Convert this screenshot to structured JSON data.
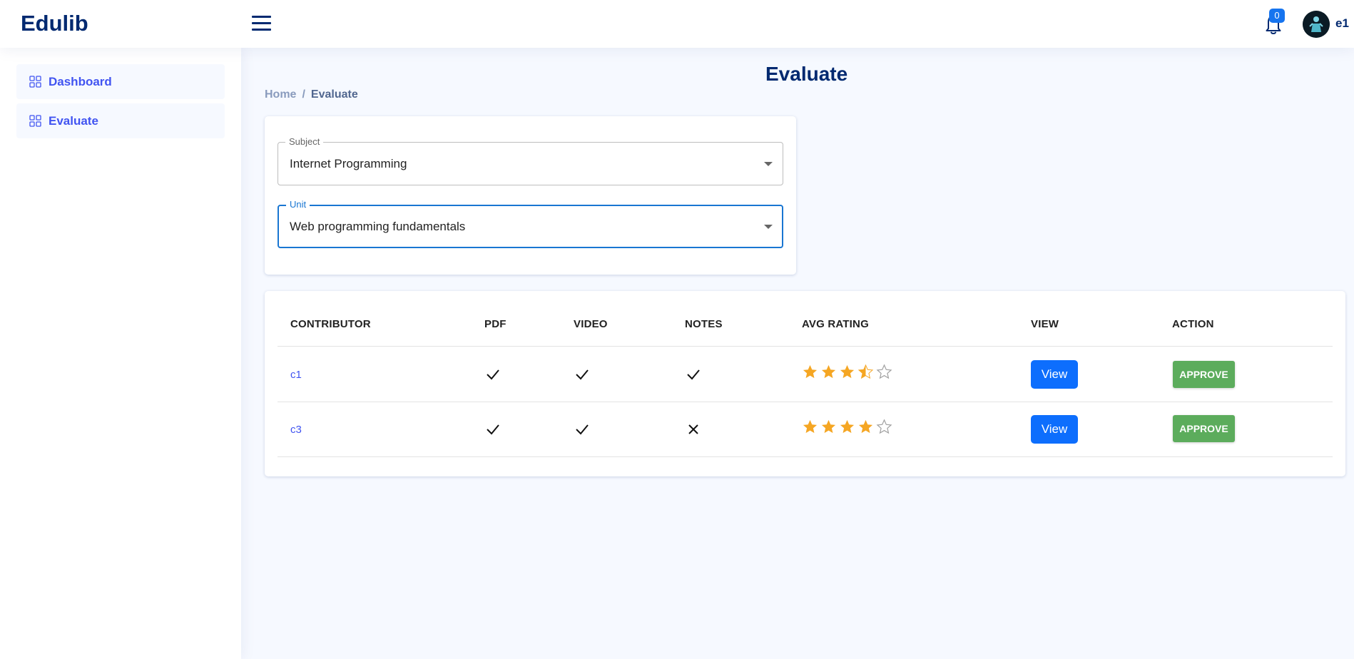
{
  "header": {
    "logo": "Edulib",
    "notifications_count": "0",
    "user_name": "e1"
  },
  "sidebar": {
    "items": [
      {
        "label": "Dashboard",
        "icon": "grid-icon"
      },
      {
        "label": "Evaluate",
        "icon": "grid-icon"
      }
    ]
  },
  "main": {
    "title": "Evaluate",
    "breadcrumb": {
      "home": "Home",
      "separator": "/",
      "current": "Evaluate"
    }
  },
  "form": {
    "subject": {
      "label": "Subject",
      "value": "Internet Programming"
    },
    "unit": {
      "label": "Unit",
      "value": "Web programming fundamentals"
    }
  },
  "table": {
    "headers": [
      "CONTRIBUTOR",
      "PDF",
      "VIDEO",
      "NOTES",
      "AVG RATING",
      "VIEW",
      "ACTION"
    ],
    "rows": [
      {
        "contributor": "c1",
        "pdf": true,
        "video": true,
        "notes": true,
        "rating": 3.5,
        "view_label": "View",
        "action_label": "APPROVE"
      },
      {
        "contributor": "c3",
        "pdf": true,
        "video": true,
        "notes": false,
        "rating": 4,
        "view_label": "View",
        "action_label": "APPROVE"
      }
    ]
  },
  "colors": {
    "brand": "#012970",
    "accent": "#4154f1",
    "view_button": "#0d6efd",
    "approve_button": "#5cac5c",
    "star": "#f5a623"
  }
}
